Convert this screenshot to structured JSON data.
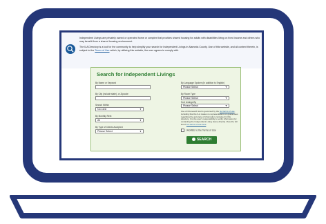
{
  "intro": {
    "paragraph1": "Independent Livings are privately owned or operated home or complex that provides shared housing for adults with disabilities living on fixed income and others who may benefit from a shared housing environment.",
    "paragraph2_a": "The ILA Directory is a tool for the community to help simplify your search for Independent Livings in Alameda County. Use of this website, and all content therein, is subject to the ",
    "paragraph2_link": "Terms of Use",
    "paragraph2_b": " which, by utilizing this website, the user agrees to comply with."
  },
  "form": {
    "title": "Search for Independent Livings",
    "name_label": "By Name or Keyword",
    "name_value": "",
    "city_label": "By City (include state), or Zipcode",
    "city_value": "",
    "within_label": "Search Within",
    "within_value": "No Limit",
    "monthly_label": "By Monthly Rent",
    "monthly_value": "All",
    "clients_label": "By Type of Clients Accepted",
    "clients_value": "Please Select",
    "language_label": "By Language Spoken (In addition to English)",
    "language_value": "Please Select",
    "room_label": "By Room Type",
    "room_value": "Please Select",
    "sort_label": "Sort Listings By",
    "sort_value": "Please Select",
    "disclaimer_a": "Use of this search tool is governed by the ",
    "disclaimer_link1": "ILA terms of use",
    "disclaimer_b": ", including that the ILA makes no representations or guarantees regarding the accuracy of information contained in this directory. It is the user's responsibility to verify information by contacting the Independent Living Home directly. View the full list of ",
    "disclaimer_link2": "ILA terms of use here",
    "disclaimer_c": ".",
    "agree_label": "I AGREE to the Terms of Use",
    "search_label": "SEARCH"
  },
  "colors": {
    "laptop": "#253778",
    "accent_green": "#2e7d32",
    "card_bg": "#eef5e4"
  },
  "icons": {
    "logo": "map-pin-house-icon",
    "search": "magnifier-icon"
  }
}
